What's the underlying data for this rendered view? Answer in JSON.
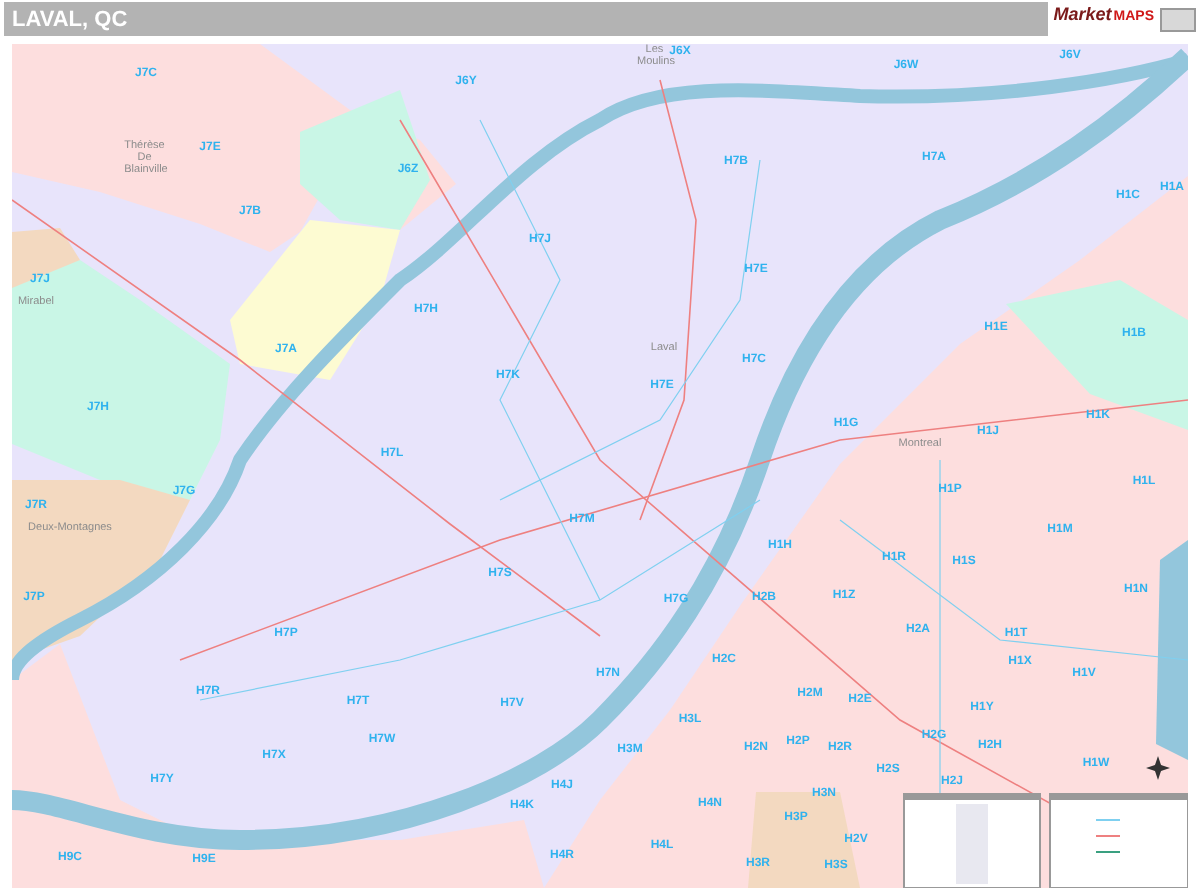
{
  "header": {
    "title": "LAVAL, QC",
    "logo": {
      "word_1": "Market",
      "word_2": "MAPS"
    }
  },
  "map": {
    "places": [
      {
        "kind": "town",
        "text": "Les Moulins"
      },
      {
        "kind": "town",
        "text": "Thérèse De Blainville"
      },
      {
        "kind": "town",
        "text": "Mirabel"
      },
      {
        "kind": "town",
        "text": "Laval"
      },
      {
        "kind": "town",
        "text": "Deux-Montagnes"
      },
      {
        "kind": "town",
        "text": "Montreal"
      },
      {
        "kind": "zone",
        "text": "J6X"
      },
      {
        "kind": "zone",
        "text": "J6W"
      },
      {
        "kind": "zone",
        "text": "J6V"
      },
      {
        "kind": "zone",
        "text": "J6Y"
      },
      {
        "kind": "zone",
        "text": "J7C"
      },
      {
        "kind": "zone",
        "text": "J7E"
      },
      {
        "kind": "zone",
        "text": "J7B"
      },
      {
        "kind": "zone",
        "text": "J6Z"
      },
      {
        "kind": "zone",
        "text": "J7J"
      },
      {
        "kind": "zone",
        "text": "H7J"
      },
      {
        "kind": "zone",
        "text": "H7H"
      },
      {
        "kind": "zone",
        "text": "J7A"
      },
      {
        "kind": "zone",
        "text": "H7K"
      },
      {
        "kind": "zone",
        "text": "J7H"
      },
      {
        "kind": "zone",
        "text": "H7L"
      },
      {
        "kind": "zone",
        "text": "H7B"
      },
      {
        "kind": "zone",
        "text": "H7A"
      },
      {
        "kind": "zone",
        "text": "H1C"
      },
      {
        "kind": "zone",
        "text": "H1A"
      },
      {
        "kind": "zone",
        "text": "H7E"
      },
      {
        "kind": "zone",
        "text": "H1E"
      },
      {
        "kind": "zone",
        "text": "H1B"
      },
      {
        "kind": "zone",
        "text": "H7C"
      },
      {
        "kind": "zone",
        "text": "H7E"
      },
      {
        "kind": "zone",
        "text": "H1K"
      },
      {
        "kind": "zone",
        "text": "H1G"
      },
      {
        "kind": "zone",
        "text": "H1J"
      },
      {
        "kind": "zone",
        "text": "J7G"
      },
      {
        "kind": "zone",
        "text": "J7R"
      },
      {
        "kind": "zone",
        "text": "J7P"
      },
      {
        "kind": "zone",
        "text": "H7M"
      },
      {
        "kind": "zone",
        "text": "H7S"
      },
      {
        "kind": "zone",
        "text": "H7P"
      },
      {
        "kind": "zone",
        "text": "H7R"
      },
      {
        "kind": "zone",
        "text": "H7T"
      },
      {
        "kind": "zone",
        "text": "H7V"
      },
      {
        "kind": "zone",
        "text": "H7W"
      },
      {
        "kind": "zone",
        "text": "H7X"
      },
      {
        "kind": "zone",
        "text": "H7Y"
      },
      {
        "kind": "zone",
        "text": "H4J"
      },
      {
        "kind": "zone",
        "text": "H4K"
      },
      {
        "kind": "zone",
        "text": "H9C"
      },
      {
        "kind": "zone",
        "text": "H9E"
      },
      {
        "kind": "zone",
        "text": "H4R"
      },
      {
        "kind": "zone",
        "text": "H1L"
      },
      {
        "kind": "zone",
        "text": "H1P"
      },
      {
        "kind": "zone",
        "text": "H1M"
      },
      {
        "kind": "zone",
        "text": "H1H"
      },
      {
        "kind": "zone",
        "text": "H1R"
      },
      {
        "kind": "zone",
        "text": "H1S"
      },
      {
        "kind": "zone",
        "text": "H1N"
      },
      {
        "kind": "zone",
        "text": "H2B"
      },
      {
        "kind": "zone",
        "text": "H1Z"
      },
      {
        "kind": "zone",
        "text": "H2A"
      },
      {
        "kind": "zone",
        "text": "H1T"
      },
      {
        "kind": "zone",
        "text": "H1X"
      },
      {
        "kind": "zone",
        "text": "H7G"
      },
      {
        "kind": "zone",
        "text": "H2C"
      },
      {
        "kind": "zone",
        "text": "H1V"
      },
      {
        "kind": "zone",
        "text": "H7N"
      },
      {
        "kind": "zone",
        "text": "H2M"
      },
      {
        "kind": "zone",
        "text": "H2E"
      },
      {
        "kind": "zone",
        "text": "H1Y"
      },
      {
        "kind": "zone",
        "text": "H3L"
      },
      {
        "kind": "zone",
        "text": "H2G"
      },
      {
        "kind": "zone",
        "text": "H2P"
      },
      {
        "kind": "zone",
        "text": "H2R"
      },
      {
        "kind": "zone",
        "text": "H2H"
      },
      {
        "kind": "zone",
        "text": "H3M"
      },
      {
        "kind": "zone",
        "text": "H2N"
      },
      {
        "kind": "zone",
        "text": "H1W"
      },
      {
        "kind": "zone",
        "text": "H2S"
      },
      {
        "kind": "zone",
        "text": "H2J"
      },
      {
        "kind": "zone",
        "text": "H3N"
      },
      {
        "kind": "zone",
        "text": "H4N"
      },
      {
        "kind": "zone",
        "text": "H3P"
      },
      {
        "kind": "zone",
        "text": "H2V"
      },
      {
        "kind": "zone",
        "text": "H4L"
      },
      {
        "kind": "zone",
        "text": "H3R"
      },
      {
        "kind": "zone",
        "text": "H3S"
      }
    ]
  }
}
